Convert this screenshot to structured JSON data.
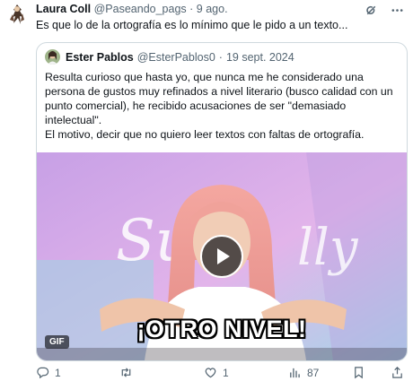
{
  "tweet": {
    "author_name": "Laura Coll",
    "author_handle": "@Paseando_pags",
    "separator": "·",
    "date": "9 ago.",
    "text": "Es que lo de la ortografía es lo mínimo que le pido a un texto..."
  },
  "quoted_tweet": {
    "author_name": "Ester Pablos",
    "author_handle": "@EsterPablos0",
    "separator": "·",
    "date": "19 sept. 2024",
    "paragraph_1": "Resulta curioso que hasta yo, que nunca me he considerado una persona de gustos muy refinados a nivel literario (busco calidad con un punto comercial), he recibido acusaciones de ser \"demasiado intelectual\".",
    "paragraph_2": "El motivo, decir que no quiero leer textos con faltas de ortografía.",
    "media": {
      "badge": "GIF",
      "caption": "¡OTRO NIVEL!"
    }
  },
  "actions": {
    "replies": "1",
    "retweets": "",
    "likes": "1",
    "views": "87"
  },
  "icons": {
    "top_right": [
      "grok-icon",
      "more-icon"
    ],
    "action_bar": [
      "reply-icon",
      "retweet-icon",
      "like-icon",
      "views-icon",
      "bookmark-icon",
      "share-icon"
    ]
  },
  "colors": {
    "text": "#0f1419",
    "secondary_text": "#536471",
    "border": "#cfd9de",
    "media_background": "#d6a9e8"
  }
}
